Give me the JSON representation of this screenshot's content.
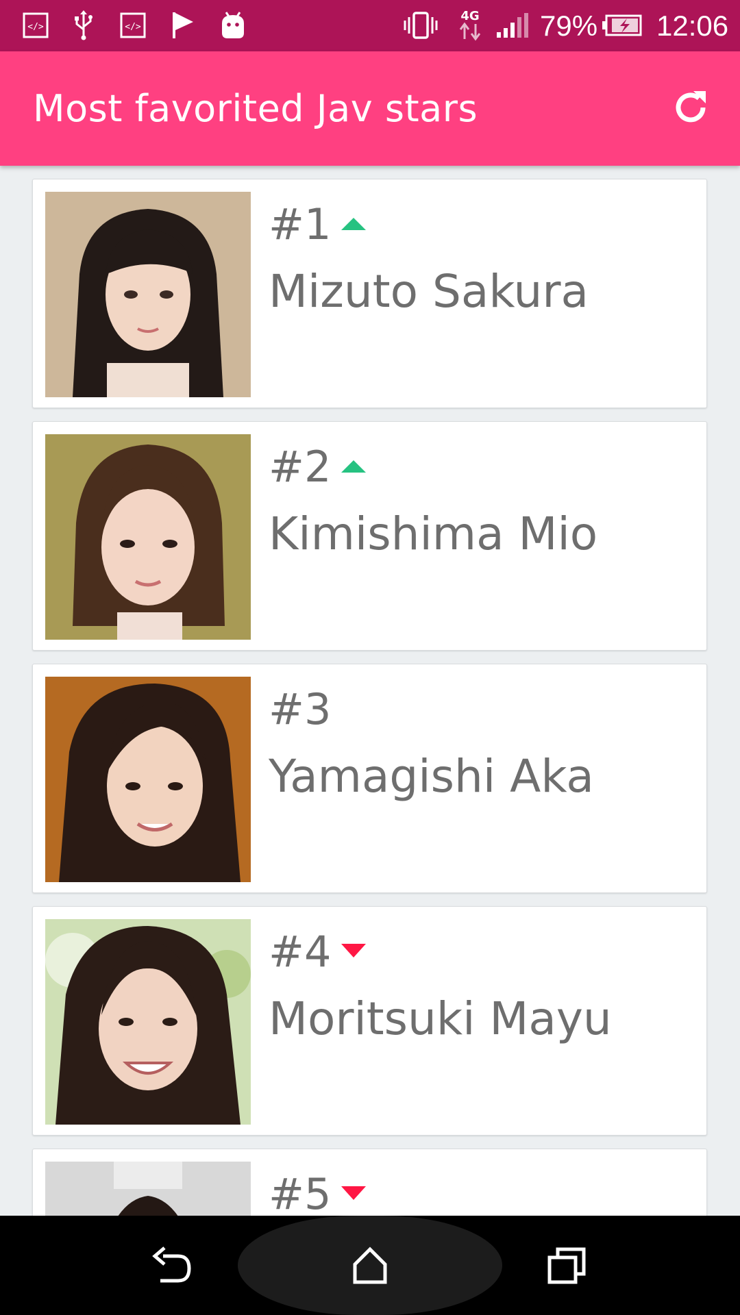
{
  "status_bar": {
    "battery": "79%",
    "time": "12:06",
    "network": "4G"
  },
  "app_bar": {
    "title": "Most favorited Jav stars",
    "refresh_icon": "refresh-icon"
  },
  "colors": {
    "status_bar": "#ad1457",
    "app_bar": "#ff4081",
    "text": "#6e6e6e",
    "trend_up": "#26c281",
    "trend_down": "#ff1744"
  },
  "stars": [
    {
      "rank": "#1",
      "name": "Mizuto Sakura",
      "trend": "up"
    },
    {
      "rank": "#2",
      "name": "Kimishima Mio",
      "trend": "up"
    },
    {
      "rank": "#3",
      "name": "Yamagishi Aka",
      "trend": "none"
    },
    {
      "rank": "#4",
      "name": "Moritsuki Mayu",
      "trend": "down"
    },
    {
      "rank": "#5",
      "name": "",
      "trend": "down"
    }
  ],
  "nav_bar": {
    "back_icon": "back-icon",
    "home_icon": "home-icon",
    "recents_icon": "recents-icon"
  }
}
